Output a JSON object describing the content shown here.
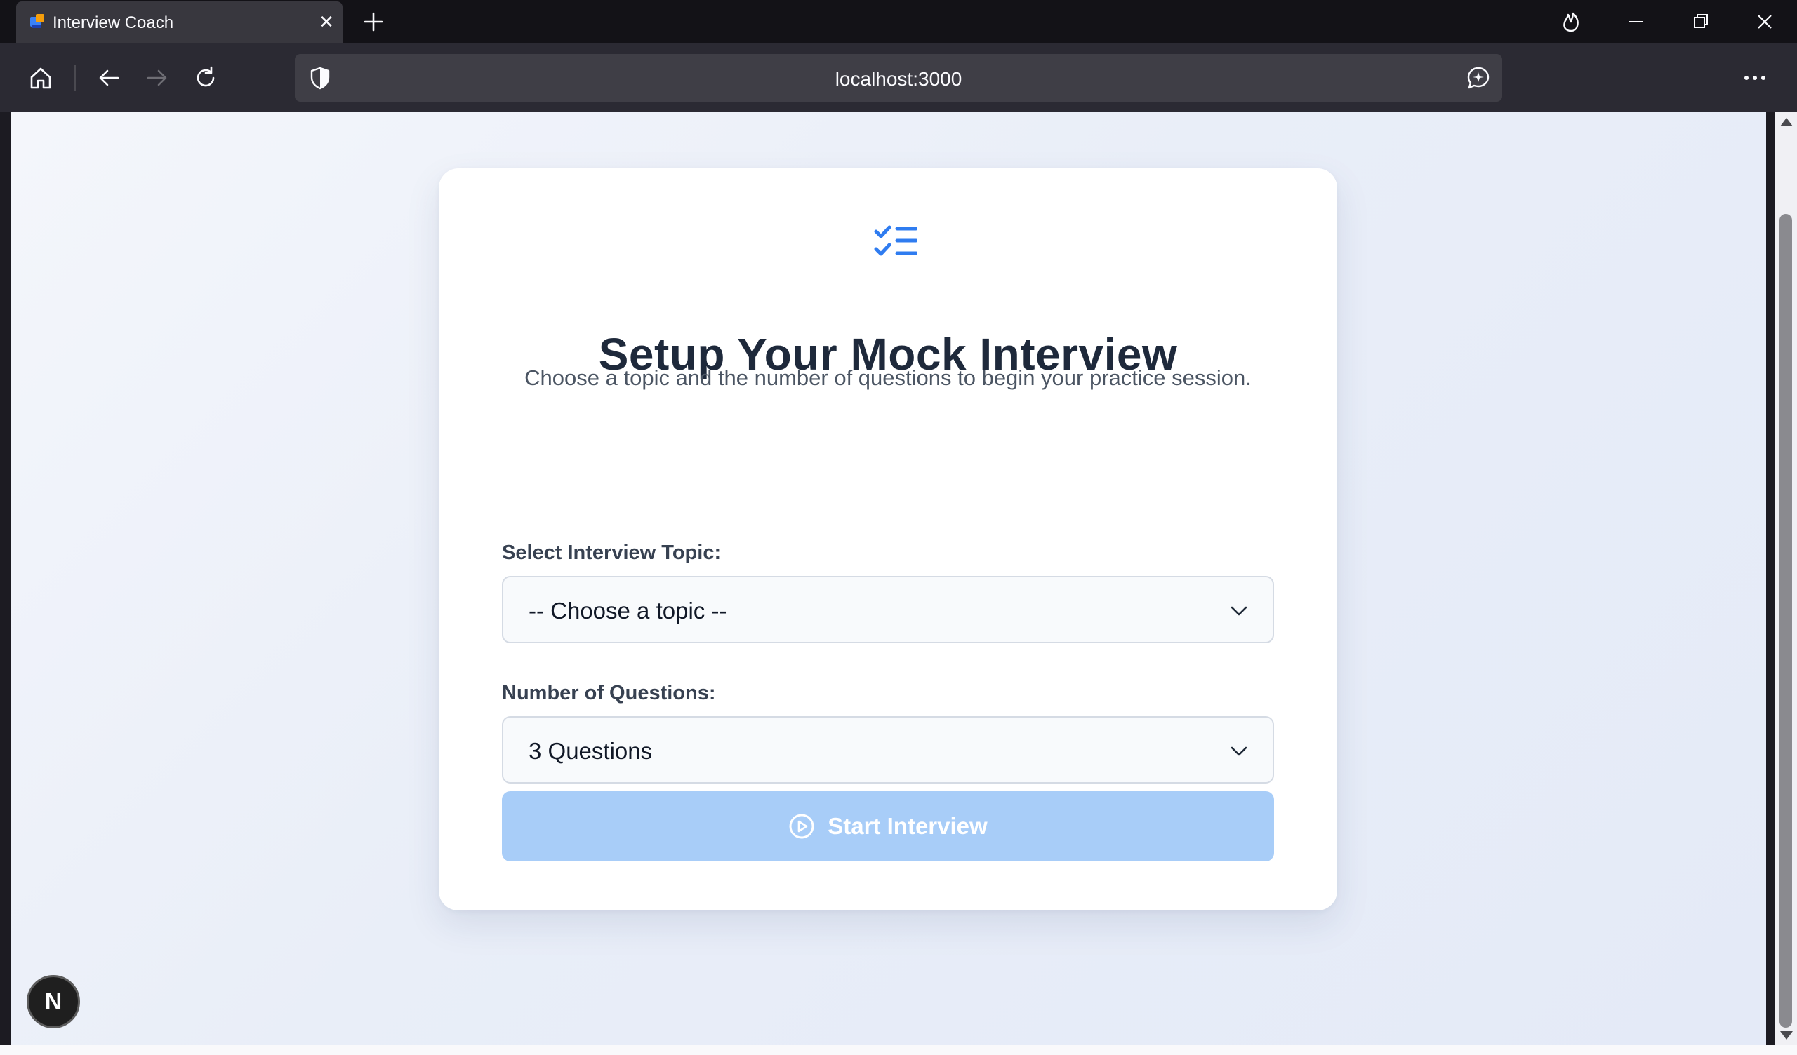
{
  "browser": {
    "tab_title": "Interview Coach",
    "tab_close": "✕",
    "url": "localhost:3000"
  },
  "page": {
    "title": "Setup Your Mock Interview",
    "subtitle": "Choose a topic and the number of questions to begin your practice session.",
    "topic_label": "Select Interview Topic:",
    "topic_value": "-- Choose a topic --",
    "questions_label": "Number of Questions:",
    "questions_value": "3 Questions",
    "start_label": "Start Interview",
    "start_disabled": true
  },
  "badge": {
    "letter": "N"
  },
  "colors": {
    "accent": "#2f7cf0",
    "button_disabled": "#a8cdf8",
    "title_text": "#1e293b"
  }
}
